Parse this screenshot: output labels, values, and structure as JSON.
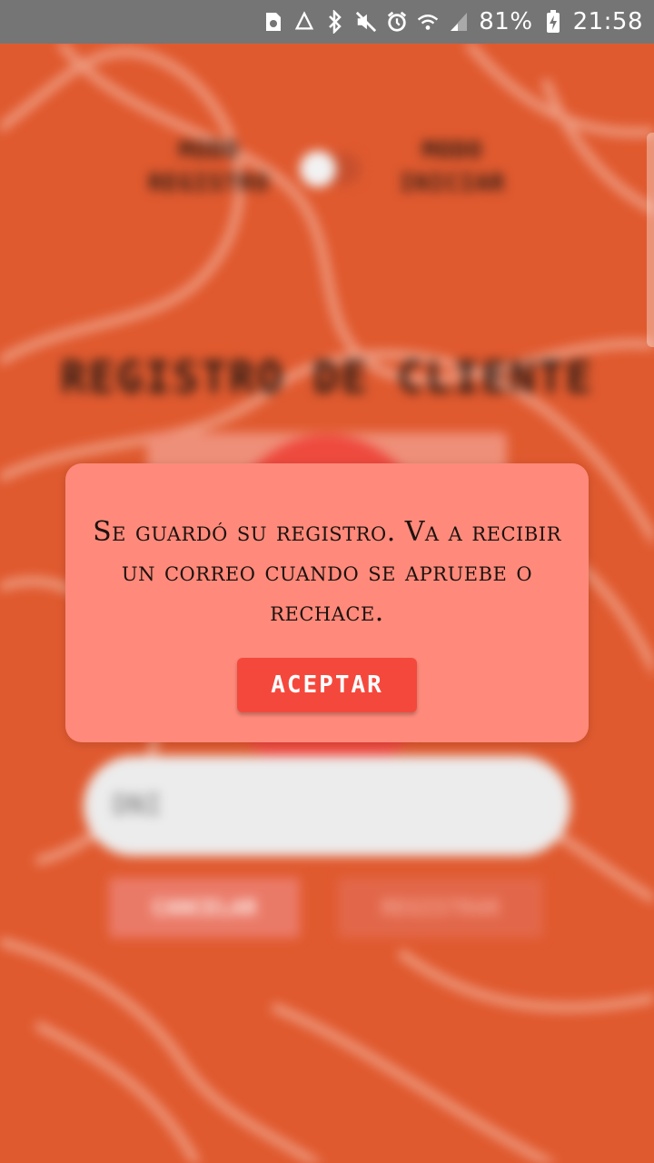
{
  "status_bar": {
    "battery_percent": "81%",
    "time": "21:58",
    "icons": [
      "sim-recycle-icon",
      "recycle-icon",
      "bluetooth-icon",
      "mute-icon",
      "alarm-icon",
      "wifi-icon",
      "signal-icon",
      "battery-charging-icon"
    ]
  },
  "background": {
    "mode_left_label": "MODO REGISTRO",
    "mode_right_label": "MODO INICIAR",
    "title": "REGISTRO DE CLIENTE",
    "dni_placeholder": "DNI",
    "cancel_label": "CANCELAR",
    "register_label": "REGISTRAR",
    "colors": {
      "background": "#e05a2f",
      "photo_circle": "#ee4a3e"
    }
  },
  "dialog": {
    "message": "Se guardó su registro. Va a recibir un correo cuando se apruebe o rechace.",
    "accept_label": "ACEPTAR",
    "colors": {
      "background": "#ff8a7b",
      "button": "#f5483c"
    }
  }
}
